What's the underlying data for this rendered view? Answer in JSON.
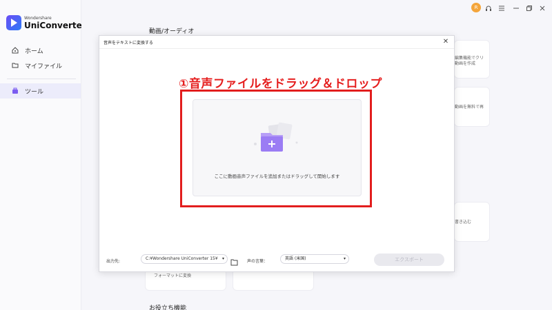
{
  "window": {
    "avatar_letter": "R",
    "controls": [
      "headset-icon",
      "menu-icon",
      "minimize-icon",
      "restore-icon",
      "close-icon"
    ]
  },
  "sidebar": {
    "logo_sub": "Wondershare",
    "logo_main": "UniConverter",
    "items": [
      {
        "label": "ホーム",
        "icon": "home-icon"
      },
      {
        "label": "マイファイル",
        "icon": "folder-icon"
      },
      {
        "label": "ツール",
        "icon": "toolbox-icon",
        "active": true
      }
    ]
  },
  "background": {
    "section_title": "動画/オーディオ",
    "card_right_1": "編集機能でクリ\n動画を作成",
    "card_right_2": "動画を無料で再",
    "card_right_3": "書き込む",
    "card_bottom_left": "フォーマットに変換",
    "footer_title": "お役立ち機能"
  },
  "dialog": {
    "title": "音声をテキストに変換する",
    "annotation": "①音声ファイルをドラッグ＆ドロップ",
    "drop_text": "ここに動画音声ファイルを追加またはドラッグして開始します",
    "output_label": "出力先:",
    "output_path": "C:¥Wondershare UniConverter 15¥",
    "language_label": "声の言葉：",
    "language_value": "英語 (米国)",
    "export_label": "エクスポート"
  },
  "colors": {
    "accent": "#7b5cf0",
    "annotation_red": "#e21d1d",
    "folder_purple": "#9b7cf4"
  }
}
